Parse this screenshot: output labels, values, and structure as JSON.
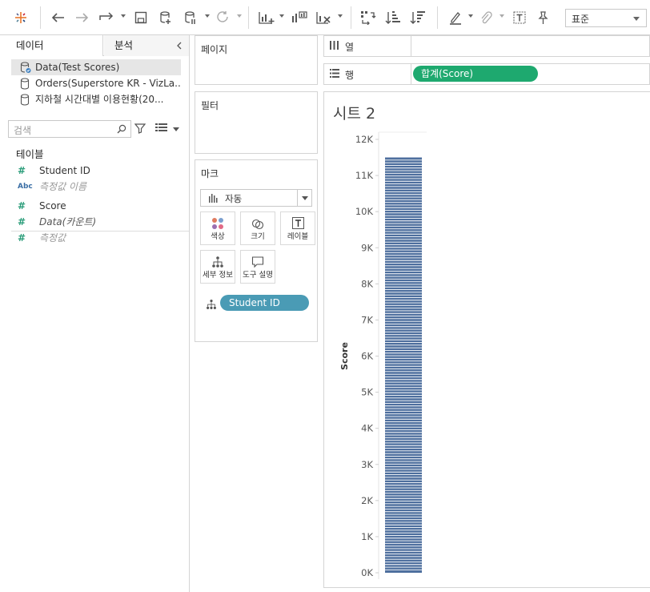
{
  "toolbar": {
    "standard_select": "표준",
    "icons": [
      "tableau-logo-icon",
      "undo-icon",
      "redo-icon",
      "redirect-icon",
      "save-icon",
      "new-datasource-icon",
      "pause-icon",
      "refresh-icon",
      "new-worksheet-icon",
      "duplicate-icon",
      "clear-icon",
      "swap-icon",
      "sort-asc-icon",
      "sort-desc-icon",
      "highlight-icon",
      "group-icon",
      "label-icon",
      "pin-icon"
    ]
  },
  "data_pane": {
    "tab_data": "데이터",
    "tab_analytics": "분석",
    "datasources": [
      {
        "label": "Data(Test Scores)",
        "selected": true
      },
      {
        "label": "Orders(Superstore KR - VizLa..."
      },
      {
        "label": "지하철 시간대별 이용현황(20..."
      }
    ],
    "search_placeholder": "검색",
    "section_title": "테이블",
    "fields": [
      {
        "icon": "#",
        "name": "Student ID"
      },
      {
        "icon": "Abc",
        "name": "측정값 이름"
      },
      {
        "icon": "#",
        "name": "Score"
      },
      {
        "icon": "#",
        "name": "Data(카운트)"
      },
      {
        "icon": "#",
        "name": "측정값"
      }
    ]
  },
  "pages_card": {
    "title": "페이지"
  },
  "filters_card": {
    "title": "필터"
  },
  "marks_card": {
    "title": "마크",
    "mark_type": "자동",
    "buttons": [
      "색상",
      "크기",
      "레이블",
      "세부 정보",
      "도구 설명"
    ],
    "detail_pill": "Student ID"
  },
  "columns_shelf": {
    "label": "열"
  },
  "rows_shelf": {
    "label": "행",
    "pill": "합계(Score)"
  },
  "sheet": {
    "title": "시트 2"
  },
  "colors": {
    "bar": "#4e6f9e",
    "pill_blue": "#4a9bb5",
    "pill_green": "#1ea96f"
  },
  "chart_data": {
    "type": "bar",
    "stacked": true,
    "title": "",
    "xlabel": "",
    "ylabel": "Score",
    "ylim": [
      0,
      12000
    ],
    "yticks": [
      "0K",
      "1K",
      "2K",
      "3K",
      "4K",
      "5K",
      "6K",
      "7K",
      "8K",
      "9K",
      "10K",
      "11K",
      "12K"
    ],
    "categories": [
      ""
    ],
    "values": [
      11500
    ],
    "segments_by": "Student ID"
  }
}
